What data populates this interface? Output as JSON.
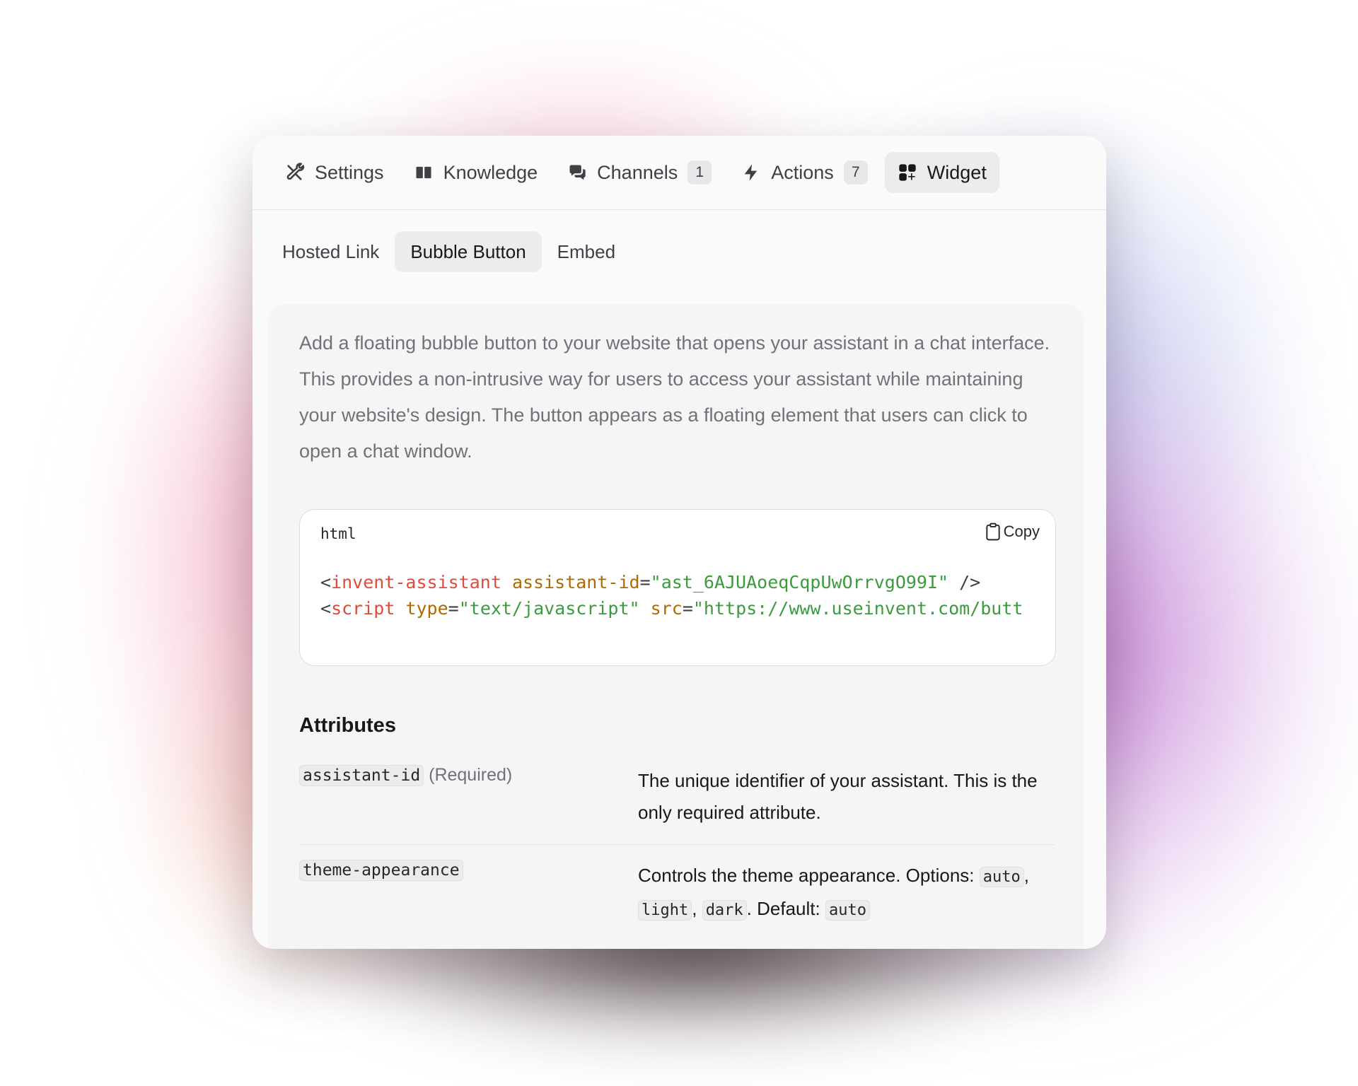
{
  "tabs": {
    "settings": "Settings",
    "knowledge": "Knowledge",
    "channels": "Channels",
    "channels_count": "1",
    "actions": "Actions",
    "actions_count": "7",
    "widget": "Widget"
  },
  "subtabs": {
    "hosted_link": "Hosted Link",
    "bubble_button": "Bubble Button",
    "embed": "Embed"
  },
  "description": "Add a floating bubble button to your website that opens your assistant in a chat interface. This provides a non-intrusive way for users to access your assistant while maintaining your website's design. The button appears as a floating element that users can click to open a chat window.",
  "code": {
    "language": "html",
    "copy_label": "Copy",
    "line1": {
      "open": "<",
      "tag": "invent-assistant",
      "sp": " ",
      "attr": "assistant-id",
      "eq": "=",
      "value": "\"ast_6AJUAoeqCqpUwOrrvgO99I\"",
      "close": " />"
    },
    "line2": {
      "open": "<",
      "tag": "script",
      "sp1": " ",
      "attr1": "type",
      "eq1": "=",
      "value1": "\"text/javascript\"",
      "sp2": " ",
      "attr2": "src",
      "eq2": "=",
      "value2": "\"https://www.useinvent.com/butt"
    }
  },
  "attributes": {
    "title": "Attributes",
    "rows": [
      {
        "name": "assistant-id",
        "note": " (Required)",
        "description": "The unique identifier of your assistant. This is the only required attribute."
      },
      {
        "name": "theme-appearance",
        "desc_prefix": "Controls the theme appearance. Options: ",
        "opt1": "auto",
        "sep1": ", ",
        "opt2": "light",
        "sep2": ", ",
        "opt3": "dark",
        "default_label": ". Default: ",
        "default_value": "auto"
      }
    ]
  },
  "colors": {
    "tag": "#e04b3c",
    "attr": "#b06a00",
    "string": "#3d9a3d"
  }
}
